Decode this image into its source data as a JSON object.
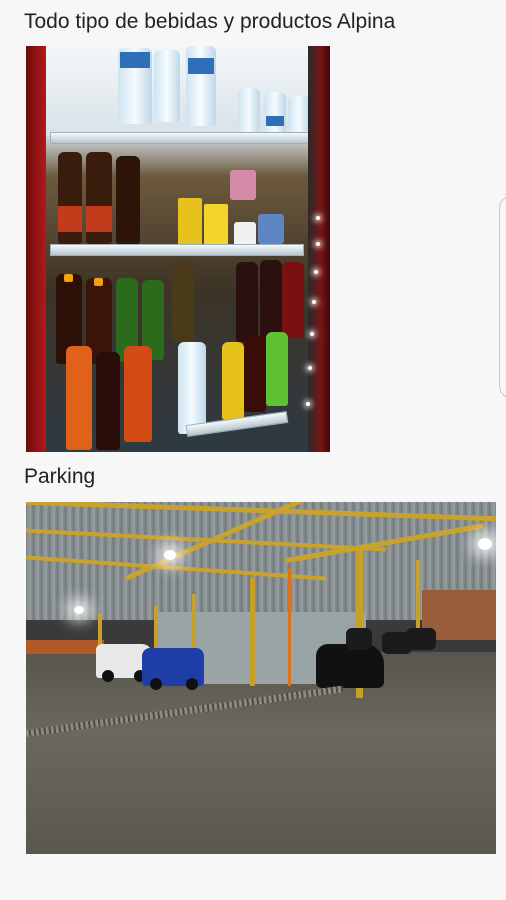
{
  "sections": [
    {
      "caption": "Todo tipo de bebidas y productos Alpina",
      "photo_subject": "drinks-fridge"
    },
    {
      "caption": "Parking",
      "photo_subject": "covered-parking-lot"
    }
  ],
  "colors": {
    "background": "#f7f7f7",
    "caption_text": "#222222",
    "fridge_frame": "#b3181a",
    "parking_beams": "#c9a32c"
  },
  "icons": {
    "edge_handle": "edge-panel-handle"
  }
}
